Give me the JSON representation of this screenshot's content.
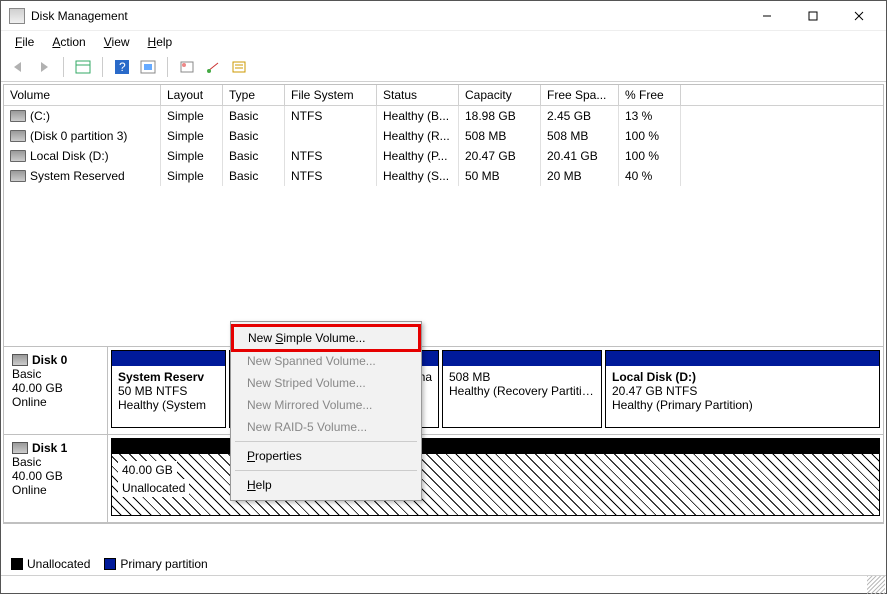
{
  "window": {
    "title": "Disk Management"
  },
  "menus": {
    "file": "File",
    "action": "Action",
    "view": "View",
    "help": "Help"
  },
  "columns": {
    "volume": "Volume",
    "layout": "Layout",
    "type": "Type",
    "filesystem": "File System",
    "status": "Status",
    "capacity": "Capacity",
    "freespace": "Free Spa...",
    "pctfree": "% Free"
  },
  "rows": [
    {
      "vol": "(C:)",
      "layout": "Simple",
      "type": "Basic",
      "fs": "NTFS",
      "status": "Healthy (B...",
      "cap": "18.98 GB",
      "free": "2.45 GB",
      "pct": "13 %"
    },
    {
      "vol": "(Disk 0 partition 3)",
      "layout": "Simple",
      "type": "Basic",
      "fs": "",
      "status": "Healthy (R...",
      "cap": "508 MB",
      "free": "508 MB",
      "pct": "100 %"
    },
    {
      "vol": "Local Disk (D:)",
      "layout": "Simple",
      "type": "Basic",
      "fs": "NTFS",
      "status": "Healthy (P...",
      "cap": "20.47 GB",
      "free": "20.41 GB",
      "pct": "100 %"
    },
    {
      "vol": "System Reserved",
      "layout": "Simple",
      "type": "Basic",
      "fs": "NTFS",
      "status": "Healthy (S...",
      "cap": "50 MB",
      "free": "20 MB",
      "pct": "40 %"
    }
  ],
  "disk0": {
    "label": "Disk 0",
    "kind": "Basic",
    "size": "40.00 GB",
    "state": "Online",
    "p0": {
      "name": "System Reserv",
      "l1": "50 MB NTFS",
      "l2": "Healthy (System"
    },
    "p1": {
      "name": "",
      "l1": "",
      "l2": "ima"
    },
    "p2": {
      "name": "",
      "l1": "508 MB",
      "l2": "Healthy (Recovery Partition"
    },
    "p3": {
      "name": "Local Disk  (D:)",
      "l1": "20.47 GB NTFS",
      "l2": "Healthy (Primary Partition)"
    }
  },
  "disk1": {
    "label": "Disk 1",
    "kind": "Basic",
    "size": "40.00 GB",
    "state": "Online",
    "p0": {
      "name": "",
      "l1": "40.00 GB",
      "l2": "Unallocated"
    }
  },
  "ctx": {
    "newsimple": "New Simple Volume...",
    "newspanned": "New Spanned Volume...",
    "newstriped": "New Striped Volume...",
    "newmirrored": "New Mirrored Volume...",
    "newraid5": "New RAID-5 Volume...",
    "properties": "Properties",
    "help": "Help"
  },
  "legend": {
    "unalloc": "Unallocated",
    "prim": "Primary partition"
  }
}
